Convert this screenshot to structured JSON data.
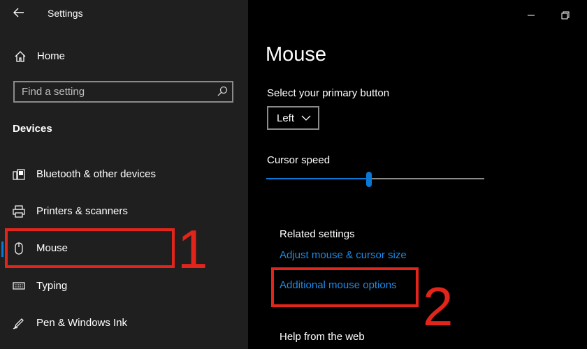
{
  "window": {
    "title": "Settings"
  },
  "sidebar": {
    "home_label": "Home",
    "search_placeholder": "Find a setting",
    "section_title": "Devices",
    "items": [
      {
        "label": "Bluetooth & other devices",
        "icon": "bluetooth-devices-icon"
      },
      {
        "label": "Printers & scanners",
        "icon": "printer-icon"
      },
      {
        "label": "Mouse",
        "icon": "mouse-icon",
        "selected": true
      },
      {
        "label": "Typing",
        "icon": "keyboard-icon"
      },
      {
        "label": "Pen & Windows Ink",
        "icon": "pen-icon"
      }
    ]
  },
  "main": {
    "title": "Mouse",
    "primary_button_label": "Select your primary button",
    "primary_button_value": "Left",
    "cursor_speed_label": "Cursor speed",
    "cursor_speed_value": 0.47,
    "related_heading": "Related settings",
    "related_links": [
      "Adjust mouse & cursor size",
      "Additional mouse options"
    ],
    "help_heading": "Help from the web"
  },
  "annotations": {
    "box1_number": "1",
    "box2_number": "2"
  },
  "colors": {
    "accent": "#0a78d7",
    "link": "#1f8ae6",
    "annotation": "#e1251b",
    "sidebar_bg": "#1f1f1f"
  }
}
